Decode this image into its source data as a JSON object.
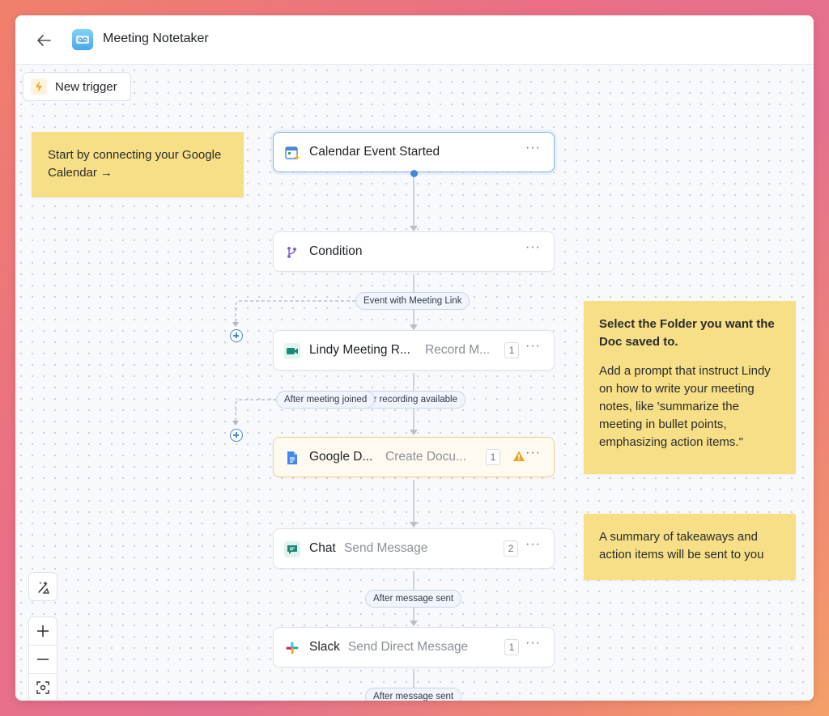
{
  "header": {
    "title": "Meeting Notetaker"
  },
  "toolbar": {
    "new_trigger_label": "New trigger"
  },
  "notes": {
    "calendar": "Start by connecting your Google Calendar →",
    "folder_title": "Select the Folder you want the Doc saved to.",
    "folder_body": "Add a prompt that instruct Lindy on how to write your meeting notes, like 'summarize the meeting in bullet points, emphasizing action items.\"",
    "summary": "A summary of takeaways and action items will be sent to you"
  },
  "nodes": [
    {
      "title": "Calendar Event Started",
      "subtitle": "",
      "count": "",
      "icon": "calendar-icon"
    },
    {
      "title": "Condition",
      "subtitle": "",
      "count": "",
      "icon": "branch-icon"
    },
    {
      "title": "Lindy Meeting R...",
      "subtitle": "Record M...",
      "count": "1",
      "icon": "meet-icon"
    },
    {
      "title": "Google D...",
      "subtitle": "Create Docu...",
      "count": "1",
      "icon": "google-docs-icon",
      "warning": true
    },
    {
      "title": "Chat",
      "subtitle": "Send Message",
      "count": "2",
      "icon": "chat-icon"
    },
    {
      "title": "Slack",
      "subtitle": "Send Direct Message",
      "count": "1",
      "icon": "slack-icon"
    }
  ],
  "more_label": "···",
  "edges": {
    "event_with_meeting_link": "Event with Meeting Link",
    "after_recording_available": "After recording available",
    "after_meeting_joined": "After meeting joined",
    "after_message_sent_1": "After message sent",
    "after_message_sent_2": "After message sent"
  },
  "colors": {
    "accent": "#4a86d8",
    "note": "#f6df86",
    "warning": "#f0a020"
  }
}
